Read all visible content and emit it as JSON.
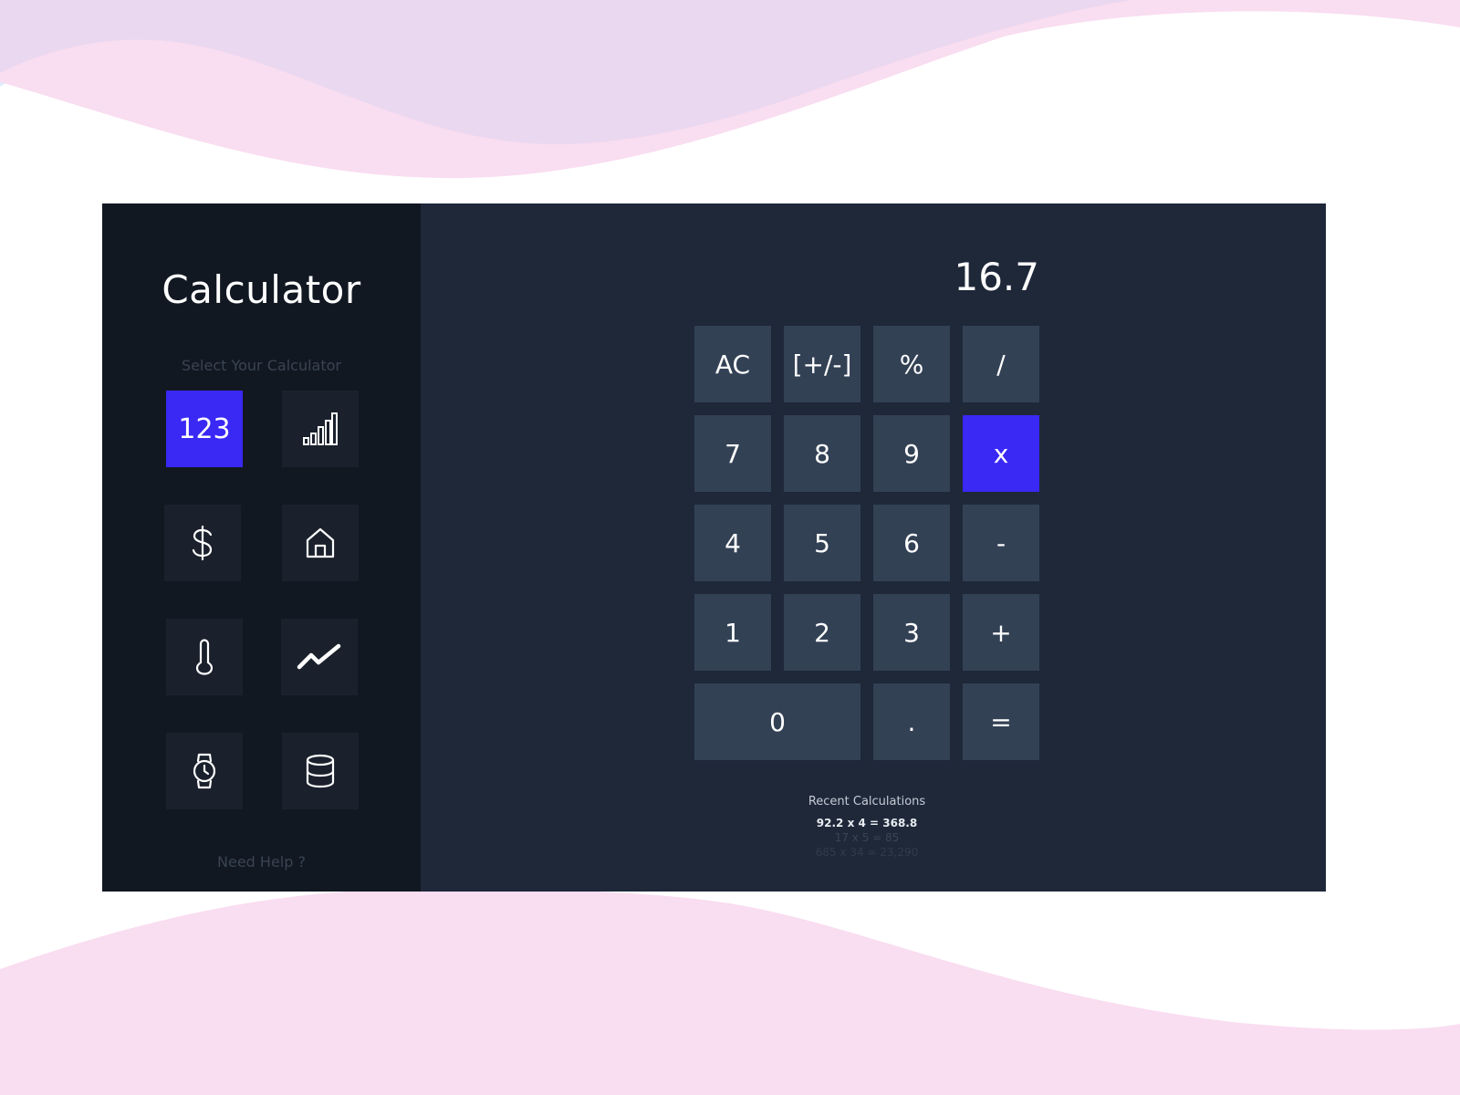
{
  "app": {
    "title": "Calculator",
    "select_label": "Select Your Calculator",
    "help_label": "Need Help ?"
  },
  "calculator_types": [
    {
      "name": "standard",
      "label": "123",
      "icon": "numbers",
      "active": true
    },
    {
      "name": "statistics",
      "icon": "bar-chart-icon",
      "active": false
    },
    {
      "name": "currency",
      "icon": "dollar-icon",
      "active": false
    },
    {
      "name": "mortgage",
      "icon": "home-icon",
      "active": false
    },
    {
      "name": "temperature",
      "icon": "thermometer-icon",
      "active": false
    },
    {
      "name": "trend",
      "icon": "trend-icon",
      "active": false
    },
    {
      "name": "time",
      "icon": "watch-icon",
      "active": false
    },
    {
      "name": "data",
      "icon": "database-icon",
      "active": false
    }
  ],
  "display": {
    "value": "16.7"
  },
  "keys": [
    {
      "label": "AC",
      "name": "clear"
    },
    {
      "label": "[+/-]",
      "name": "sign"
    },
    {
      "label": "%",
      "name": "percent"
    },
    {
      "label": "/",
      "name": "divide"
    },
    {
      "label": "7",
      "name": "7"
    },
    {
      "label": "8",
      "name": "8"
    },
    {
      "label": "9",
      "name": "9"
    },
    {
      "label": "x",
      "name": "multiply",
      "active": true
    },
    {
      "label": "4",
      "name": "4"
    },
    {
      "label": "5",
      "name": "5"
    },
    {
      "label": "6",
      "name": "6"
    },
    {
      "label": "-",
      "name": "subtract"
    },
    {
      "label": "1",
      "name": "1"
    },
    {
      "label": "2",
      "name": "2"
    },
    {
      "label": "3",
      "name": "3"
    },
    {
      "label": "+",
      "name": "add"
    },
    {
      "label": "0",
      "name": "0"
    },
    {
      "label": ".",
      "name": "decimal"
    },
    {
      "label": "=",
      "name": "equals"
    }
  ],
  "recent": {
    "title": "Recent Calculations",
    "items": [
      "92.2 x 4 = 368.8",
      "17 x 5 = 85",
      "685 x 34 = 23,290"
    ]
  },
  "colors": {
    "accent": "#3a28f5",
    "sidebar_bg": "#111822",
    "main_bg": "#1e2839",
    "key_bg": "#334155",
    "wave_pink": "#f9ddf0",
    "wave_lavender": "#ead8f0",
    "wave_blue": "#dcecfc"
  }
}
